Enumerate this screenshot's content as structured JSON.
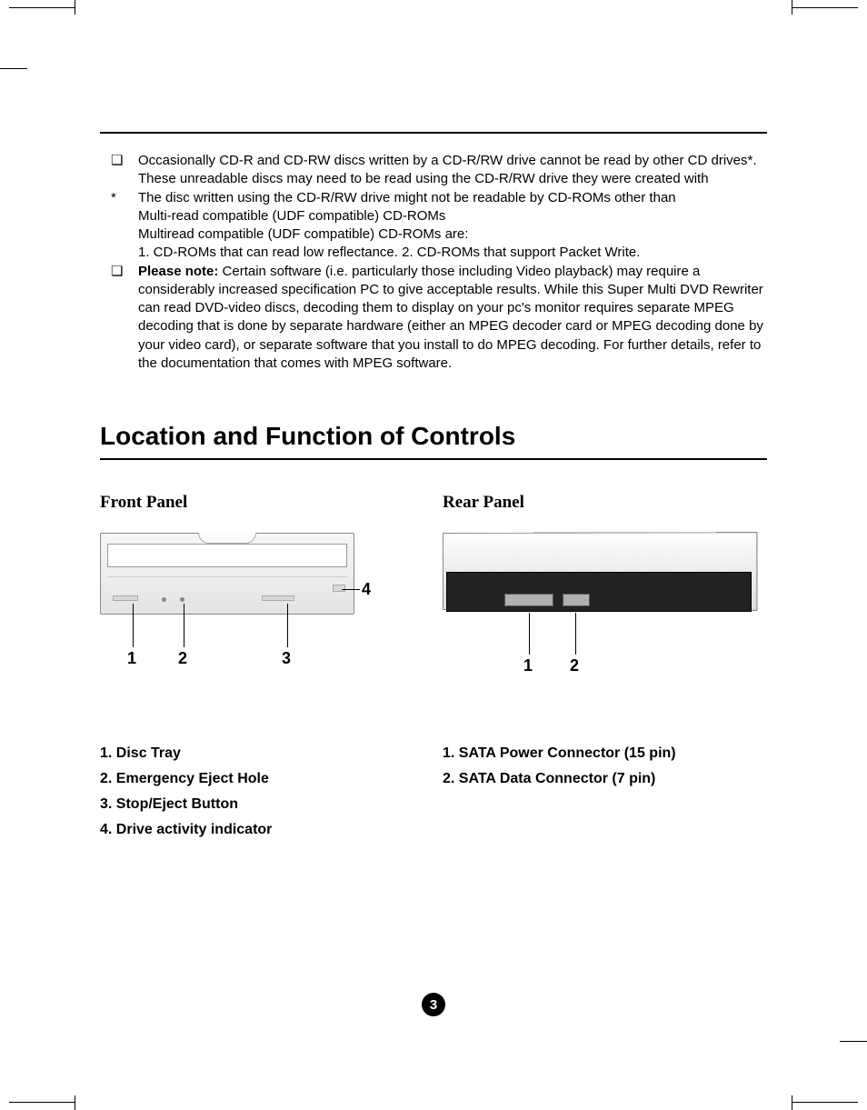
{
  "notes": {
    "item1": {
      "marker": "❏",
      "line1": "Occasionally CD-R and CD-RW discs written by a CD-R/RW drive cannot be read by other CD drives*.",
      "line2": "These unreadable discs may need to be read using the CD-R/RW drive they were created with"
    },
    "item2": {
      "marker": "*",
      "line1": "The disc written using the CD-R/RW drive might not be readable by CD-ROMs other than",
      "line2": "Multi-read compatible (UDF compatible) CD-ROMs",
      "line3": "Multiread compatible (UDF compatible) CD-ROMs are:",
      "sub_a": "1. CD-ROMs that can read low reflectance.",
      "sub_b": "2. CD-ROMs that support Packet Write."
    },
    "item3": {
      "marker": "❏",
      "lead": "Please note:",
      "rest": " Certain software (i.e. particularly those including Video playback) may require a considerably increased specification PC to give acceptable results. While this Super Multi DVD Rewriter can read DVD-video discs, decoding them to display on your pc's monitor requires separate MPEG decoding that is done by separate hardware (either an MPEG decoder card or MPEG decoding done by your video card), or separate software that you install to do MPEG decoding. For further details, refer to the documentation that comes with MPEG software."
    }
  },
  "section_title": "Location and Function of Controls",
  "front": {
    "title": "Front Panel",
    "callouts": {
      "c1": "1",
      "c2": "2",
      "c3": "3",
      "c4": "4"
    },
    "legend": {
      "i1": "1. Disc Tray",
      "i2": "2. Emergency Eject Hole",
      "i3": "3. Stop/Eject Button",
      "i4": "4. Drive activity indicator"
    }
  },
  "rear": {
    "title": "Rear Panel",
    "callouts": {
      "c1": "1",
      "c2": "2"
    },
    "legend": {
      "i1": "1. SATA Power Connector (15 pin)",
      "i2": "2. SATA Data Connector (7 pin)"
    }
  },
  "page_number": "3"
}
